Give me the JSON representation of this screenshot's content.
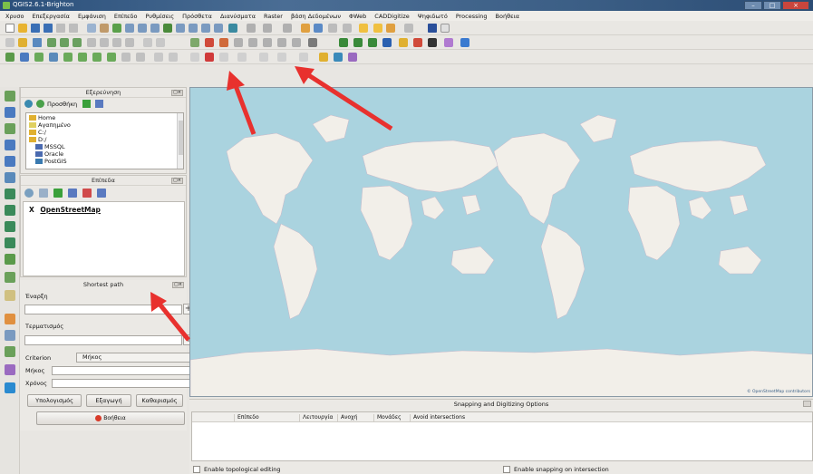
{
  "window": {
    "title": "QGIS2.6.1-Brighton"
  },
  "menubar": [
    "Χρυσο",
    "Επεξεργασία",
    "Εμφάνιση",
    "Επίπεδο",
    "Ρυθμίσεις",
    "Πρόσθετα",
    "Διανύσματα",
    "Raster",
    "βάση Δεδομένων",
    "ΦWeb",
    "CADDigitize",
    "Ψηφιδωτό",
    "Processing",
    "Βοήθεια"
  ],
  "browser_panel": {
    "title": "Εξερεύνηση",
    "add_label": "Προσθήκη",
    "tree": [
      "Home",
      "Αγαπημένο",
      "C:/",
      "D:/",
      "MSSQL",
      "Oracle",
      "PostGIS"
    ]
  },
  "layers_panel": {
    "title": "Επίπεδα",
    "layers": [
      {
        "name": "OpenStreetMap"
      }
    ]
  },
  "shortest_path_panel": {
    "title": "Shortest path",
    "start_label": "Έναρξη",
    "stop_label": "Τερματισμός",
    "criterion_label": "Criterion",
    "criterion_value": "Μήκος",
    "length_label": "Μήκος",
    "time_label": "Χρόνος",
    "calculate_label": "Υπολογισμός",
    "export_label": "Εξαγωγή",
    "clear_label": "Καθαρισμός",
    "help_label": "Βοήθεια"
  },
  "map": {
    "attribution": "© OpenStreetMap contributors"
  },
  "snapping_panel": {
    "title": "Snapping and Digitizing Options",
    "columns": [
      "Επίπεδο",
      "Λειτουργία",
      "Ανοχή",
      "Μονάδες",
      "Avoid intersections"
    ],
    "enable_topological_label": "Enable topological editing",
    "enable_snapping_intersection_label": "Enable snapping on intersection"
  },
  "colors": {
    "ocean": "#aad3df",
    "land": "#f2efe9",
    "arrow": "#e8312e",
    "titlebar": "#2a4f7a"
  }
}
